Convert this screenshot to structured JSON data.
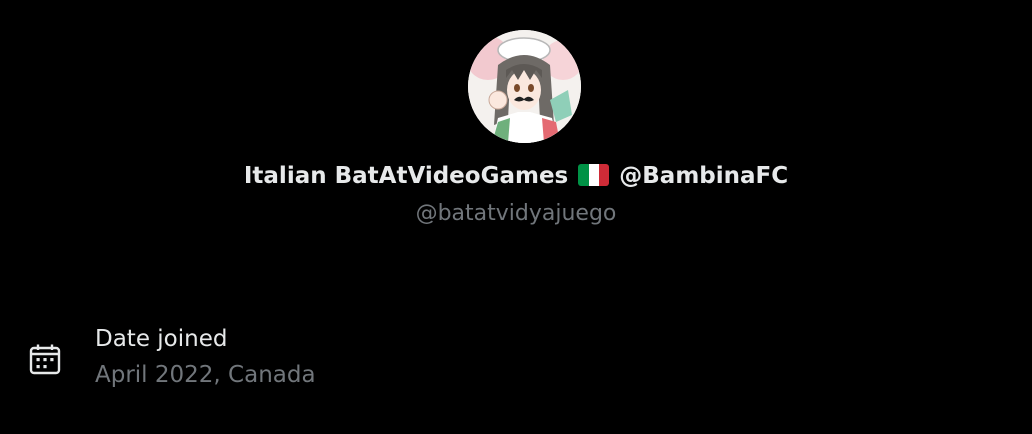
{
  "profile": {
    "display_name": "Italian BatAtVideoGames",
    "name_suffix": "@BambinaFC",
    "flag_icon": "italy-flag-icon",
    "handle": "@batatvidyajuego",
    "avatar_icon": "anime-avatar"
  },
  "about": {
    "date_joined_icon": "calendar-icon",
    "date_joined_label": "Date joined",
    "date_joined_value": "April 2022, Canada"
  },
  "colors": {
    "background": "#000000",
    "primary_text": "#e7e9ea",
    "secondary_text": "#71767b",
    "flag_green": "#009246",
    "flag_white": "#ffffff",
    "flag_red": "#ce2b37"
  }
}
